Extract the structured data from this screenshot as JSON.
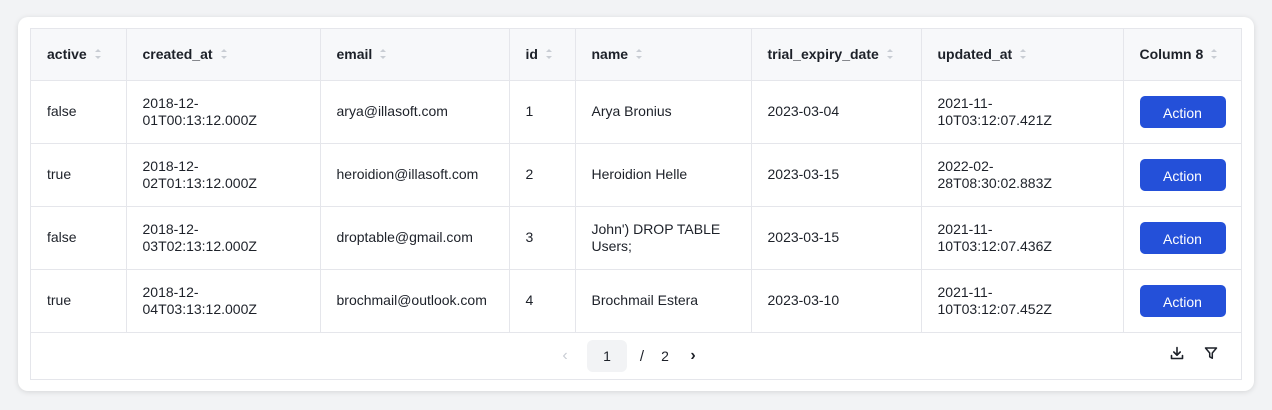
{
  "table": {
    "columns": [
      "active",
      "created_at",
      "email",
      "id",
      "name",
      "trial_expiry_date",
      "updated_at",
      "Column 8"
    ],
    "rows": [
      {
        "active": "false",
        "created_at": "2018-12-01T00:13:12.000Z",
        "email": "arya@illasoft.com",
        "id": "1",
        "name": "Arya Bronius",
        "trial_expiry_date": "2023-03-04",
        "updated_at": "2021-11-10T03:12:07.421Z",
        "action": "Action"
      },
      {
        "active": "true",
        "created_at": "2018-12-02T01:13:12.000Z",
        "email": "heroidion@illasoft.com",
        "id": "2",
        "name": "Heroidion Helle",
        "trial_expiry_date": "2023-03-15",
        "updated_at": "2022-02-28T08:30:02.883Z",
        "action": "Action"
      },
      {
        "active": "false",
        "created_at": "2018-12-03T02:13:12.000Z",
        "email": "droptable@gmail.com",
        "id": "3",
        "name": "John') DROP TABLE Users;",
        "trial_expiry_date": "2023-03-15",
        "updated_at": "2021-11-10T03:12:07.436Z",
        "action": "Action"
      },
      {
        "active": "true",
        "created_at": "2018-12-04T03:13:12.000Z",
        "email": "brochmail@outlook.com",
        "id": "4",
        "name": "Brochmail Estera",
        "trial_expiry_date": "2023-03-10",
        "updated_at": "2021-11-10T03:12:07.452Z",
        "action": "Action"
      }
    ]
  },
  "pagination": {
    "prev_icon": "chevron-left-icon",
    "current_page": "1",
    "separator": "/",
    "total_pages": "2",
    "next_icon": "chevron-right-icon"
  },
  "toolbar": {
    "download_icon": "download-icon",
    "filter_icon": "filter-icon"
  },
  "colors": {
    "accent": "#2450d9",
    "header_bg": "#f7f8fa",
    "border": "#e5e6eb"
  }
}
